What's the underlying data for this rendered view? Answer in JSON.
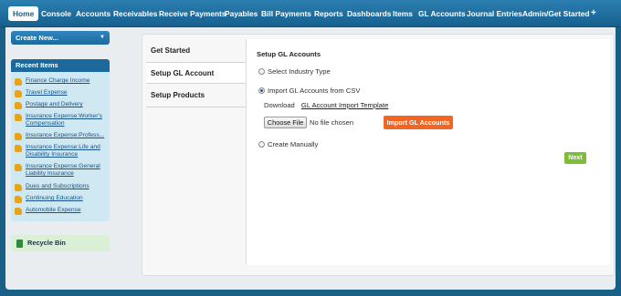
{
  "nav": {
    "items": [
      "Home",
      "Console",
      "Accounts",
      "Receivables",
      "Receive Payments",
      "Payables",
      "Bill Payments",
      "Reports",
      "Dashboards",
      "Items",
      "GL Accounts",
      "Journal Entries",
      "Admin/Get Started"
    ],
    "add_label": "+"
  },
  "sidebar": {
    "create_new": "Create New...",
    "recent_title": "Recent Items",
    "recent_items": [
      "Finance Charge Income",
      "Travel Expense",
      "Postage and Delivery",
      "Insurance Expense:Worker's Compensation",
      "Insurance Expense:Profess...",
      "Insurance Expense:Life and Disability Insurance",
      "Insurance Expense:General Liability Insurance",
      "Dues and Subscriptions",
      "Continuing Education",
      "Automobile Expense"
    ],
    "recycle_bin": "Recycle Bin"
  },
  "setup": {
    "tabs": [
      "Get Started",
      "Setup GL Account",
      "Setup Products"
    ],
    "title": "Setup GL Accounts",
    "option_industry": "Select Industry Type",
    "option_csv": "Import GL Accounts from CSV",
    "download_label": "Download",
    "template_link": "GL Account Import Template",
    "choose_file": "Choose File",
    "no_file": "No file chosen",
    "import_button": "Import GL Accounts",
    "option_manual": "Create Manually",
    "next": "Next"
  },
  "colors": {
    "nav_bg": "#1f6f9f",
    "accent_orange": "#f26522",
    "accent_green": "#7ebd3a",
    "sidebar_bg": "#cfe8f1"
  }
}
